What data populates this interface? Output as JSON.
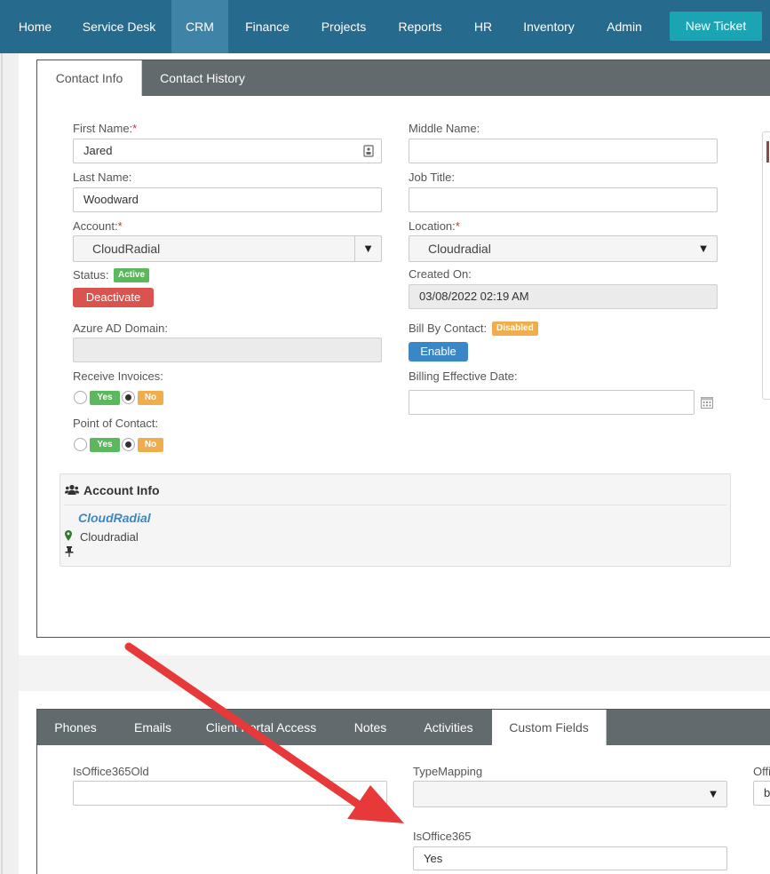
{
  "nav": {
    "items": [
      "Home",
      "Service Desk",
      "CRM",
      "Finance",
      "Projects",
      "Reports",
      "HR",
      "Inventory",
      "Admin"
    ],
    "active": "CRM",
    "new_ticket": "New Ticket"
  },
  "contact_tabs": [
    "Contact Info",
    "Contact History"
  ],
  "form": {
    "first_name_label": "First Name:",
    "first_name": "Jared",
    "middle_name_label": "Middle Name:",
    "middle_name": "",
    "last_name_label": "Last Name:",
    "last_name": "Woodward",
    "job_title_label": "Job Title:",
    "job_title": "",
    "account_label": "Account:",
    "account": "CloudRadial",
    "location_label": "Location:",
    "location": "Cloudradial",
    "status_label": "Status:",
    "status_badge": "Active",
    "deactivate_button": "Deactivate",
    "created_on_label": "Created On:",
    "created_on": "03/08/2022 02:19 AM",
    "azure_label": "Azure AD Domain:",
    "azure_domain": "",
    "bill_by_contact_label": "Bill By Contact:",
    "bill_badge": "Disabled",
    "enable_button": "Enable",
    "receive_invoices_label": "Receive Invoices:",
    "billing_effective_label": "Billing Effective Date:",
    "billing_effective_date": "",
    "point_of_contact_label": "Point of Contact:",
    "yes": "Yes",
    "no": "No",
    "required_mark": "*"
  },
  "account_info": {
    "title": "Account Info",
    "name": "CloudRadial",
    "location": "Cloudradial"
  },
  "bottom_tabs": [
    "Phones",
    "Emails",
    "Client Portal Access",
    "Notes",
    "Activities",
    "Custom Fields"
  ],
  "bottom_active": "Custom Fields",
  "custom_fields": {
    "is_office_365_old_label": "IsOffice365Old",
    "is_office_365_old": "",
    "type_mapping_label": "TypeMapping",
    "type_mapping": "",
    "is_office_365_label": "IsOffice365",
    "is_office_365": "Yes",
    "off_label": "Offi",
    "off_value": "b"
  },
  "colors": {
    "nav_bg": "#266b8d",
    "nav_active": "#3f84a6",
    "new_ticket": "#1ba4b3",
    "tabbar": "#616a6d",
    "annotation_arrow": "#e8393a"
  }
}
